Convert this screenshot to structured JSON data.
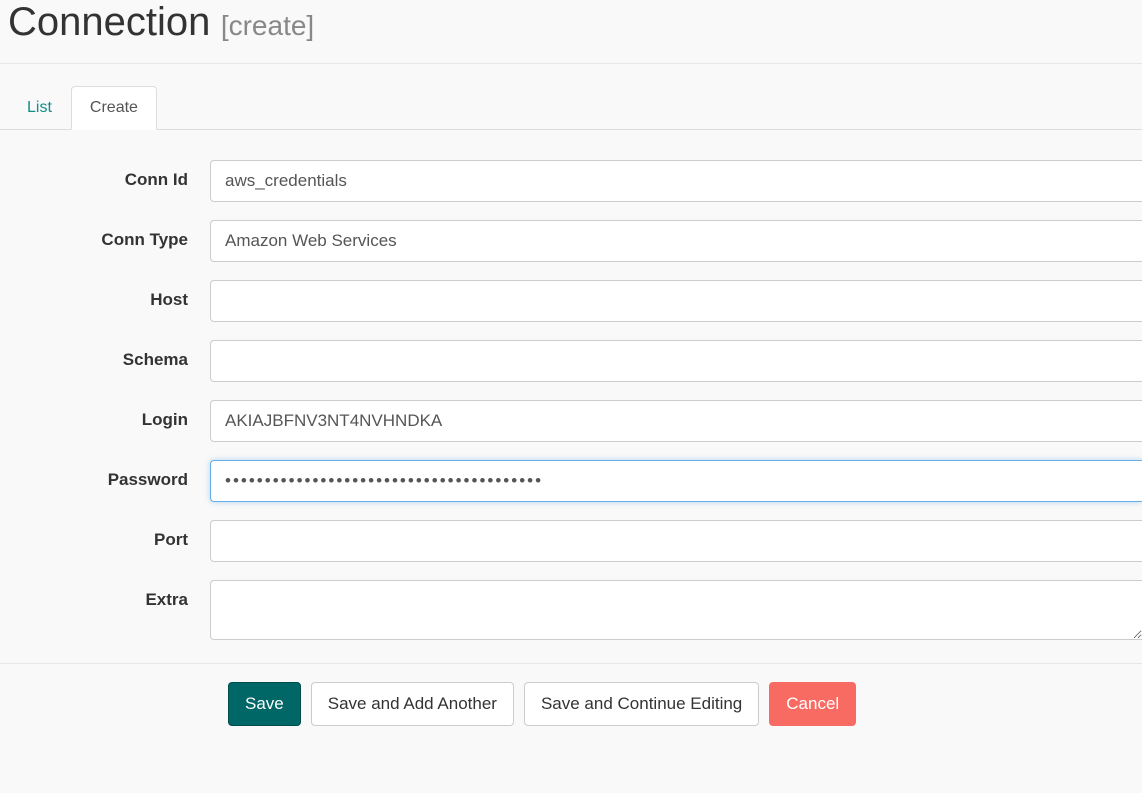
{
  "header": {
    "title": "Connection",
    "subtitle": "[create]"
  },
  "tabs": {
    "list": "List",
    "create": "Create"
  },
  "form": {
    "conn_id": {
      "label": "Conn Id",
      "value": "aws_credentials"
    },
    "conn_type": {
      "label": "Conn Type",
      "value": "Amazon Web Services"
    },
    "host": {
      "label": "Host",
      "value": ""
    },
    "schema": {
      "label": "Schema",
      "value": ""
    },
    "login": {
      "label": "Login",
      "value": "AKIAJBFNV3NT4NVHNDKA"
    },
    "password": {
      "label": "Password",
      "value": "••••••••••••••••••••••••••••••••••••••••"
    },
    "port": {
      "label": "Port",
      "value": ""
    },
    "extra": {
      "label": "Extra",
      "value": ""
    }
  },
  "buttons": {
    "save": "Save",
    "save_add": "Save and Add Another",
    "save_continue": "Save and Continue Editing",
    "cancel": "Cancel"
  }
}
